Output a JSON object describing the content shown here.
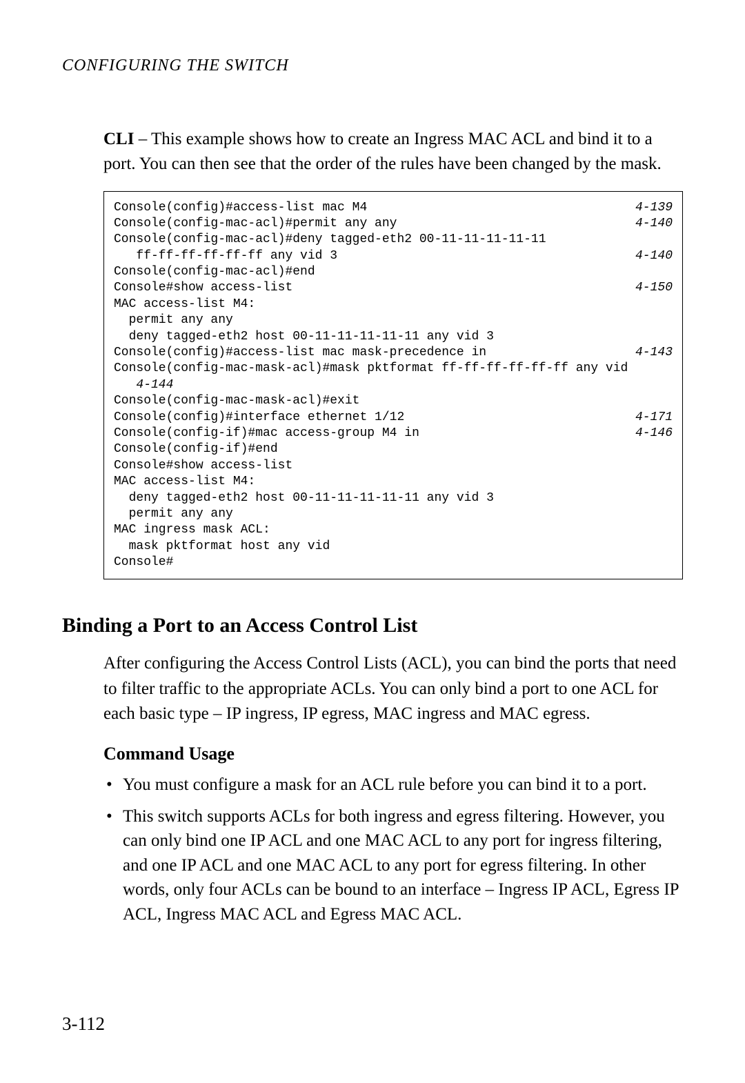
{
  "header": "CONFIGURING THE SWITCH",
  "intro_bold": "CLI",
  "intro_text": " – This example shows how to create an Ingress MAC ACL and bind it to a port. You can then see that the order of the rules have been changed by the mask.",
  "code": [
    {
      "cmd": "Console(config)#access-list mac M4",
      "ref": "4-139"
    },
    {
      "cmd": "Console(config-mac-acl)#permit any any",
      "ref": "4-140"
    },
    {
      "cmd": "Console(config-mac-acl)#deny tagged-eth2 00-11-11-11-11-11",
      "ref": ""
    },
    {
      "cmd": "   ff-ff-ff-ff-ff-ff any vid 3",
      "ref": "4-140"
    },
    {
      "cmd": "Console(config-mac-acl)#end",
      "ref": ""
    },
    {
      "cmd": "Console#show access-list",
      "ref": "4-150"
    },
    {
      "cmd": "MAC access-list M4:",
      "ref": ""
    },
    {
      "cmd": "  permit any any",
      "ref": ""
    },
    {
      "cmd": "  deny tagged-eth2 host 00-11-11-11-11-11 any vid 3",
      "ref": ""
    },
    {
      "cmd": "Console(config)#access-list mac mask-precedence in",
      "ref": "4-143"
    },
    {
      "cmd": "Console(config-mac-mask-acl)#mask pktformat ff-ff-ff-ff-ff-ff any vid",
      "ref": ""
    },
    {
      "cmd": "   4-144",
      "ref": "",
      "italic": true
    },
    {
      "cmd": "Console(config-mac-mask-acl)#exit",
      "ref": ""
    },
    {
      "cmd": "Console(config)#interface ethernet 1/12",
      "ref": "4-171"
    },
    {
      "cmd": "Console(config-if)#mac access-group M4 in",
      "ref": "4-146"
    },
    {
      "cmd": "Console(config-if)#end",
      "ref": ""
    },
    {
      "cmd": "Console#show access-list",
      "ref": ""
    },
    {
      "cmd": "MAC access-list M4:",
      "ref": ""
    },
    {
      "cmd": "  deny tagged-eth2 host 00-11-11-11-11-11 any vid 3",
      "ref": ""
    },
    {
      "cmd": "  permit any any",
      "ref": ""
    },
    {
      "cmd": "MAC ingress mask ACL:",
      "ref": ""
    },
    {
      "cmd": "  mask pktformat host any vid",
      "ref": ""
    },
    {
      "cmd": "Console#",
      "ref": ""
    }
  ],
  "section_heading": "Binding a Port to an Access Control List",
  "section_body": "After configuring the Access Control Lists (ACL), you can bind the ports that need to filter traffic to the appropriate ACLs. You can only bind a port to one ACL for each basic type – IP ingress, IP egress, MAC ingress and MAC egress.",
  "sub_heading": "Command Usage",
  "bullets": [
    "You must configure a mask for an ACL rule before you can bind it to a port.",
    "This switch supports ACLs for both ingress and egress filtering. However, you can only bind one IP ACL and one MAC ACL to any port for ingress filtering, and one IP ACL and one MAC ACL to any port for egress filtering. In other words, only four ACLs can be bound to an interface – Ingress IP ACL, Egress IP ACL, Ingress MAC ACL and Egress MAC ACL."
  ],
  "page_number": "3-112"
}
